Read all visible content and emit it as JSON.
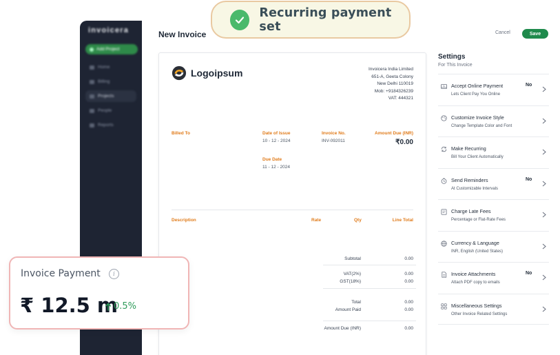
{
  "toast": {
    "text": "Recurring payment set",
    "icon": "check-icon",
    "accent": "#4ab96b"
  },
  "sidebar": {
    "logo": "invoicera",
    "add_project": "Add Project",
    "items": [
      {
        "label": "Home",
        "icon": "home-icon"
      },
      {
        "label": "Billing",
        "icon": "billing-icon"
      },
      {
        "label": "Projects",
        "icon": "folder-icon"
      },
      {
        "label": "People",
        "icon": "people-icon"
      },
      {
        "label": "Reports",
        "icon": "chart-icon"
      }
    ]
  },
  "header": {
    "title": "New Invoice",
    "cancel_label": "Cancel",
    "save_label": "Save"
  },
  "invoice": {
    "logo_text": "Logoipsum",
    "company": {
      "name": "Invoicera India Limited",
      "address1": "651-A, Geeta Colony",
      "address2": "New Delhi 110019",
      "mob": "Mob: +9184326239",
      "vat": "VAT: 444321"
    },
    "billed_to_label": "Billed To",
    "date_of_issue_label": "Date of Issue",
    "date_of_issue": "10 - 12 - 2024",
    "invoice_no_label": "Invoice No.",
    "invoice_no": "INV-092011",
    "amount_due_label": "Amount Due (INR)",
    "amount_due": "₹0.00",
    "due_date_label": "Due Date",
    "due_date": "11 - 12 - 2024",
    "columns": {
      "description": "Description",
      "rate": "Rate",
      "qty": "Qty",
      "line_total": "Line Total"
    },
    "totals": {
      "subtotal_label": "Subtotal",
      "subtotal": "0.00",
      "vat_label": "VAT(2%)",
      "vat": "0.00",
      "gst_label": "GST(18%)",
      "gst": "0.00",
      "total_label": "Total",
      "total": "0.00",
      "amount_paid_label": "Amount Paid",
      "amount_paid": "0.00",
      "amount_due_label": "Amount Due (INR)",
      "amount_due": "0.00"
    }
  },
  "settings": {
    "title": "Settings",
    "subtitle": "For This Invoice",
    "items": [
      {
        "name": "Accept Online Payment",
        "desc": "Lets Client Pay You Online",
        "badge": "No",
        "icon": "payment-icon"
      },
      {
        "name": "Customize Invoice Style",
        "desc": "Change Template Color and Font",
        "badge": "",
        "icon": "palette-icon"
      },
      {
        "name": "Make Recurring",
        "desc": "Bill Your Client Automatically",
        "badge": "",
        "icon": "repeat-icon"
      },
      {
        "name": "Send Reminders",
        "desc": "At Customizable Intervals",
        "badge": "No",
        "icon": "clock-icon"
      },
      {
        "name": "Charge Late Fees",
        "desc": "Percentage or Flat-Rate Fees",
        "badge": "",
        "icon": "fee-icon"
      },
      {
        "name": "Currency & Language",
        "desc": "INR, English (United States)",
        "badge": "",
        "icon": "globe-icon"
      },
      {
        "name": "Invoice Attachments",
        "desc": "Attach PDF copy to emails",
        "badge": "No",
        "icon": "attachment-icon"
      },
      {
        "name": "Miscellaneous Settings",
        "desc": "Other Invoice Related Settings",
        "badge": "",
        "icon": "settings-icon"
      }
    ]
  },
  "payment_card": {
    "title": "Invoice Payment",
    "info_glyph": "i",
    "amount": "₹ 12.5 m",
    "change": "0.5%",
    "change_color": "#2e9b5a"
  },
  "colors": {
    "brand_green": "#1f8a4c",
    "label_orange": "#e07b1a",
    "sidebar_bg": "#1e2433"
  }
}
